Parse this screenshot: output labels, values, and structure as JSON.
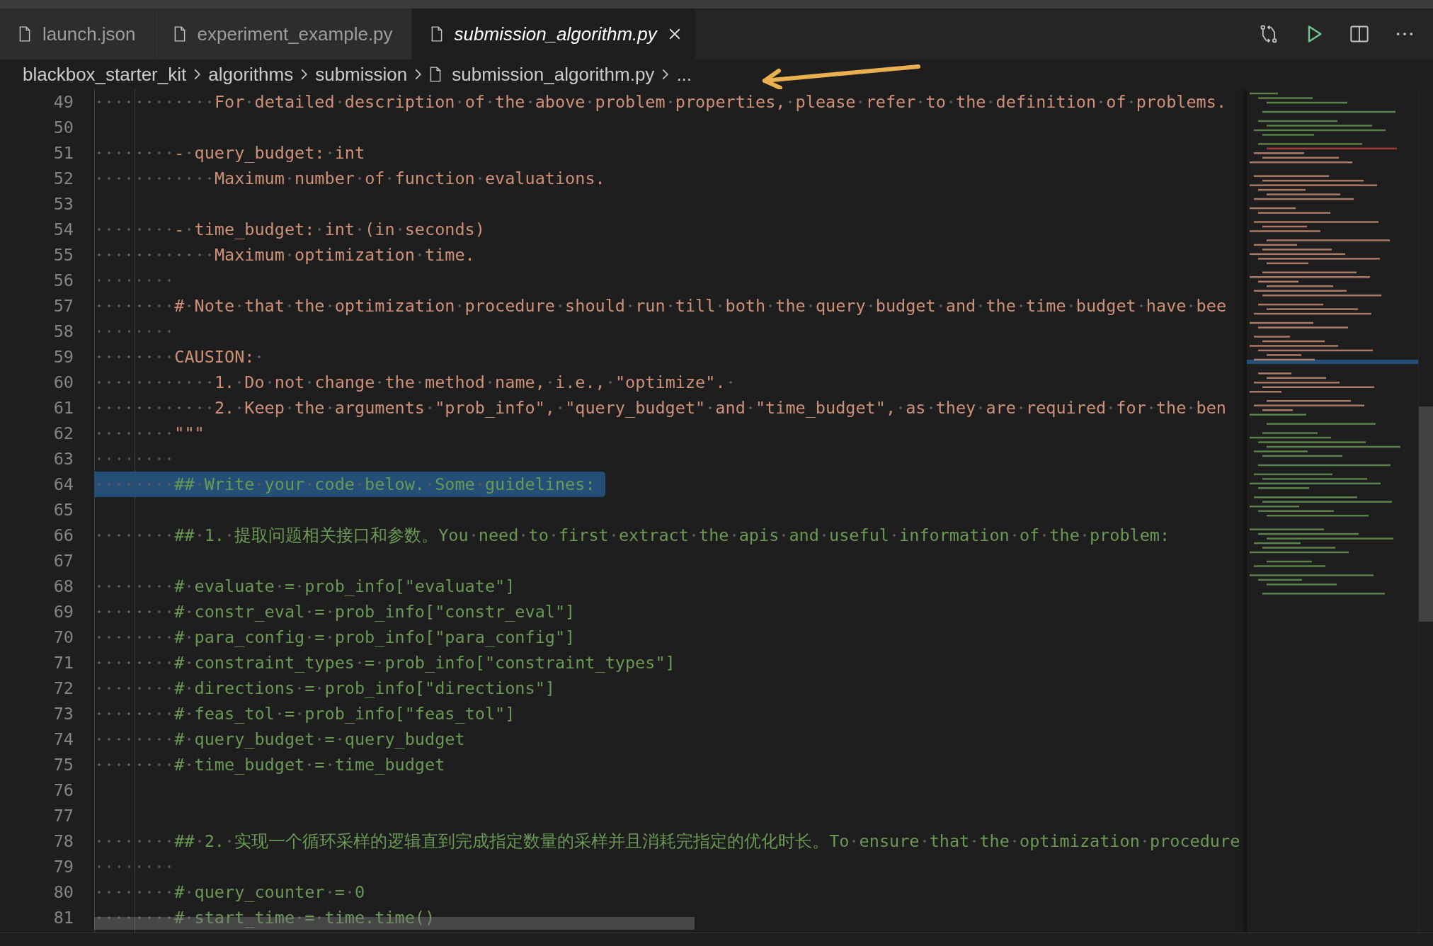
{
  "tabs": [
    {
      "label": "launch.json",
      "selected": false
    },
    {
      "label": "experiment_example.py",
      "selected": false
    },
    {
      "label": "submission_algorithm.py",
      "selected": true
    }
  ],
  "breadcrumb": [
    {
      "label": "blackbox_starter_kit",
      "kind": "folder"
    },
    {
      "label": "algorithms",
      "kind": "folder"
    },
    {
      "label": "submission",
      "kind": "folder"
    },
    {
      "label": "submission_algorithm.py",
      "kind": "file"
    },
    {
      "label": "...",
      "kind": "more"
    }
  ],
  "lines": [
    {
      "number": "49",
      "kind": "docstring",
      "selected": false,
      "text": "            For detailed description of the above problem properties, please refer to the definition of problems."
    },
    {
      "number": "50",
      "kind": "blank"
    },
    {
      "number": "51",
      "kind": "docstring",
      "selected": false,
      "text": "        - query_budget: int"
    },
    {
      "number": "52",
      "kind": "docstring",
      "selected": false,
      "text": "            Maximum number of function evaluations."
    },
    {
      "number": "53",
      "kind": "blank"
    },
    {
      "number": "54",
      "kind": "docstring",
      "selected": false,
      "text": "        - time_budget: int (in seconds)"
    },
    {
      "number": "55",
      "kind": "docstring",
      "selected": false,
      "text": "            Maximum optimization time."
    },
    {
      "number": "56",
      "kind": "whitespace",
      "selected": false
    },
    {
      "number": "57",
      "kind": "docstring",
      "selected": false,
      "text": "        # Note that the optimization procedure should run till both the query budget and the time budget have bee"
    },
    {
      "number": "58",
      "kind": "whitespace",
      "selected": false
    },
    {
      "number": "59",
      "kind": "docstring",
      "selected": false,
      "text": "        CAUSION: "
    },
    {
      "number": "60",
      "kind": "docstring",
      "selected": false,
      "text": "            1. Do not change the method name, i.e., \"optimize\". "
    },
    {
      "number": "61",
      "kind": "docstring",
      "selected": false,
      "text": "            2. Keep the arguments \"prob_info\", \"query_budget\" and \"time_budget\", as they are required for the ben"
    },
    {
      "number": "62",
      "kind": "docstring",
      "selected": false,
      "text": "        \"\"\""
    },
    {
      "number": "63",
      "kind": "whitespace",
      "selected": false
    },
    {
      "number": "64",
      "kind": "comment",
      "selected": true,
      "text": "        ## Write your code below. Some guidelines:"
    },
    {
      "number": "65",
      "kind": "blank"
    },
    {
      "number": "66",
      "kind": "comment",
      "selected": false,
      "text": "        ## 1. 提取问题相关接口和参数。You need to first extract the apis and useful information of the problem:"
    },
    {
      "number": "67",
      "kind": "blank"
    },
    {
      "number": "68",
      "kind": "comment",
      "selected": false,
      "text": "        # evaluate = prob_info[\"evaluate\"]"
    },
    {
      "number": "69",
      "kind": "comment",
      "selected": false,
      "text": "        # constr_eval = prob_info[\"constr_eval\"]"
    },
    {
      "number": "70",
      "kind": "comment",
      "selected": false,
      "text": "        # para_config = prob_info[\"para_config\"]"
    },
    {
      "number": "71",
      "kind": "comment",
      "selected": false,
      "text": "        # constraint_types = prob_info[\"constraint_types\"]"
    },
    {
      "number": "72",
      "kind": "comment",
      "selected": false,
      "text": "        # directions = prob_info[\"directions\"]"
    },
    {
      "number": "73",
      "kind": "comment",
      "selected": false,
      "text": "        # feas_tol = prob_info[\"feas_tol\"]"
    },
    {
      "number": "74",
      "kind": "comment",
      "selected": false,
      "text": "        # query_budget = query_budget"
    },
    {
      "number": "75",
      "kind": "comment",
      "selected": false,
      "text": "        # time_budget = time_budget"
    },
    {
      "number": "76",
      "kind": "blank"
    },
    {
      "number": "77",
      "kind": "blank"
    },
    {
      "number": "78",
      "kind": "comment",
      "selected": false,
      "text": "        ## 2. 实现一个循环采样的逻辑直到完成指定数量的采样并且消耗完指定的优化时长。To ensure that the optimization procedure"
    },
    {
      "number": "79",
      "kind": "whitespace",
      "selected": false
    },
    {
      "number": "80",
      "kind": "comment",
      "selected": false,
      "text": "        # query_counter = 0"
    },
    {
      "number": "81",
      "kind": "comment",
      "selected": false,
      "text": "        # start_time = time.time()"
    }
  ]
}
